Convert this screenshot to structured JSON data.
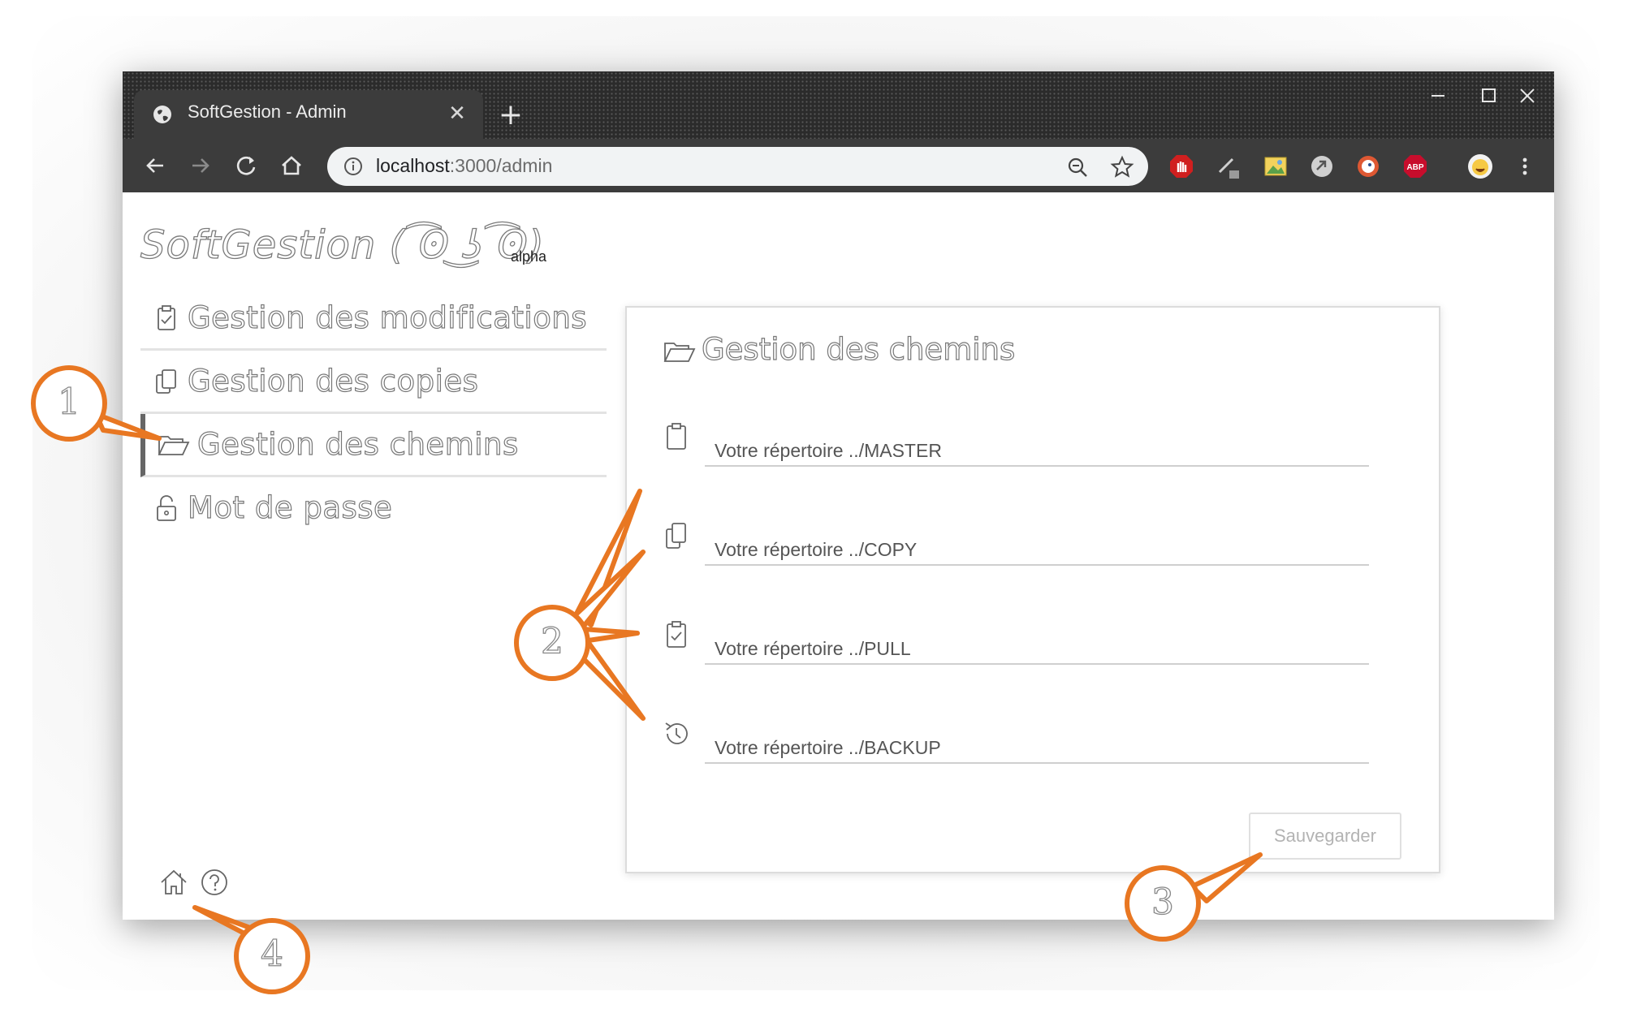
{
  "browser": {
    "tab_title": "SoftGestion - Admin",
    "tab_close": "✕",
    "new_tab": "+",
    "url_host": "localhost",
    "url_path": ":3000/admin"
  },
  "app": {
    "logo": "SoftGestion ( ͡ʘ ͜ʖ ͡ʘ)",
    "badge": "alpha"
  },
  "sidebar": {
    "items": [
      {
        "label": "Gestion des modifications",
        "icon": "clipboard-check-icon"
      },
      {
        "label": "Gestion des copies",
        "icon": "copy-icon"
      },
      {
        "label": "Gestion des chemins",
        "icon": "folder-open-icon",
        "active": true
      },
      {
        "label": "Mot de passe",
        "icon": "unlock-icon"
      }
    ]
  },
  "panel": {
    "title": "Gestion des chemins",
    "fields": [
      {
        "placeholder": "Votre répertoire ../MASTER",
        "icon": "clipboard-icon"
      },
      {
        "placeholder": "Votre répertoire ../COPY",
        "icon": "copy-icon"
      },
      {
        "placeholder": "Votre répertoire ../PULL",
        "icon": "clipboard-check-icon"
      },
      {
        "placeholder": "Votre répertoire ../BACKUP",
        "icon": "history-icon"
      }
    ],
    "save_label": "Sauvegarder"
  },
  "footer": {
    "icons": [
      "home-icon",
      "help-icon"
    ]
  },
  "callouts": [
    "1",
    "2",
    "3",
    "4"
  ],
  "colors": {
    "callout": "#e87722",
    "chrome_dark": "#2b2b2b",
    "toolbar": "#3c3c3c"
  }
}
